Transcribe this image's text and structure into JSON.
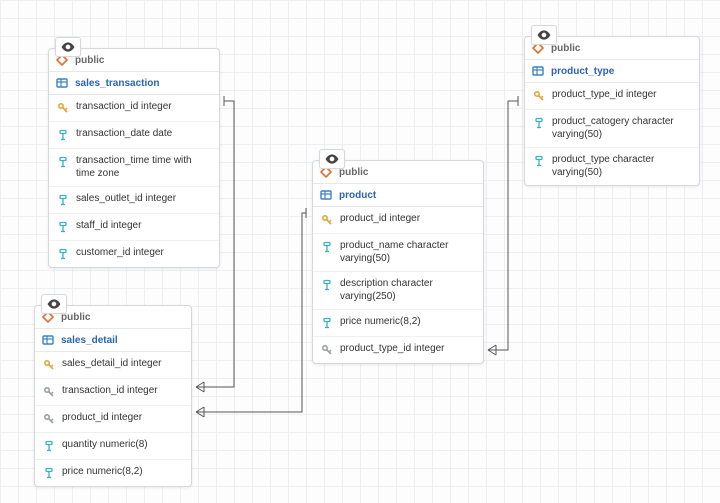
{
  "schema_label": "public",
  "tables": {
    "sales_transaction": {
      "name": "sales_transaction",
      "columns": [
        {
          "kind": "pk",
          "text": "transaction_id integer"
        },
        {
          "kind": "col",
          "text": "transaction_date date"
        },
        {
          "kind": "col",
          "text": "transaction_time time with time zone"
        },
        {
          "kind": "col",
          "text": "sales_outlet_id integer"
        },
        {
          "kind": "col",
          "text": "staff_id integer"
        },
        {
          "kind": "col",
          "text": "customer_id integer"
        }
      ]
    },
    "sales_detail": {
      "name": "sales_detail",
      "columns": [
        {
          "kind": "pk",
          "text": "sales_detail_id integer"
        },
        {
          "kind": "fk",
          "text": "transaction_id integer"
        },
        {
          "kind": "fk",
          "text": "product_id integer"
        },
        {
          "kind": "col",
          "text": "quantity numeric(8)"
        },
        {
          "kind": "col",
          "text": "price numeric(8,2)"
        }
      ]
    },
    "product": {
      "name": "product",
      "columns": [
        {
          "kind": "pk",
          "text": "product_id integer"
        },
        {
          "kind": "col",
          "text": "product_name character varying(50)"
        },
        {
          "kind": "col",
          "text": "description character varying(250)"
        },
        {
          "kind": "col",
          "text": "price numeric(8,2)"
        },
        {
          "kind": "fk",
          "text": "product_type_id integer"
        }
      ]
    },
    "product_type": {
      "name": "product_type",
      "columns": [
        {
          "kind": "pk",
          "text": "product_type_id integer"
        },
        {
          "kind": "col",
          "text": "product_catogery character varying(50)"
        },
        {
          "kind": "col",
          "text": "product_type character varying(50)"
        }
      ]
    }
  },
  "relationships": [
    {
      "from": "sales_detail.transaction_id",
      "to": "sales_transaction.transaction_id"
    },
    {
      "from": "sales_detail.product_id",
      "to": "product.product_id"
    },
    {
      "from": "product.product_type_id",
      "to": "product_type.product_type_id"
    }
  ]
}
